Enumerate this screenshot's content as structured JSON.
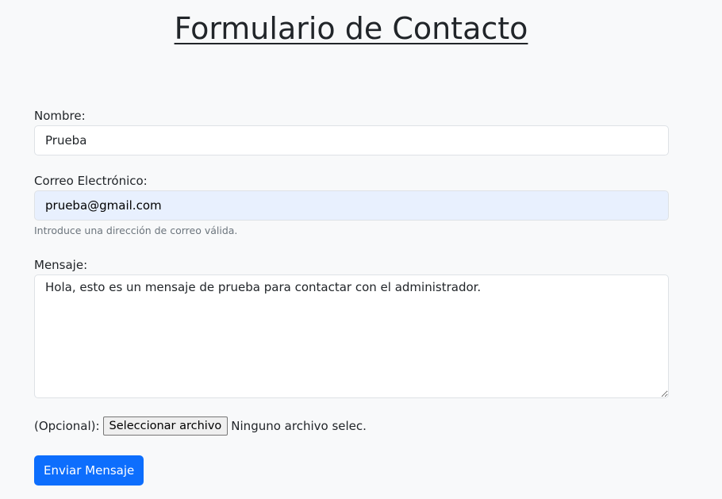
{
  "title": "Formulario de Contacto",
  "name": {
    "label": "Nombre:",
    "value": "Prueba"
  },
  "email": {
    "label": "Correo Electrónico:",
    "value": "prueba@gmail.com",
    "help": "Introduce una dirección de correo válida."
  },
  "message": {
    "label": "Mensaje:",
    "value": "Hola, esto es un mensaje de prueba para contactar con el administrador."
  },
  "file": {
    "label": "(Opcional):",
    "button": "Seleccionar archivo",
    "status": "Ninguno archivo selec."
  },
  "submit": "Enviar Mensaje"
}
